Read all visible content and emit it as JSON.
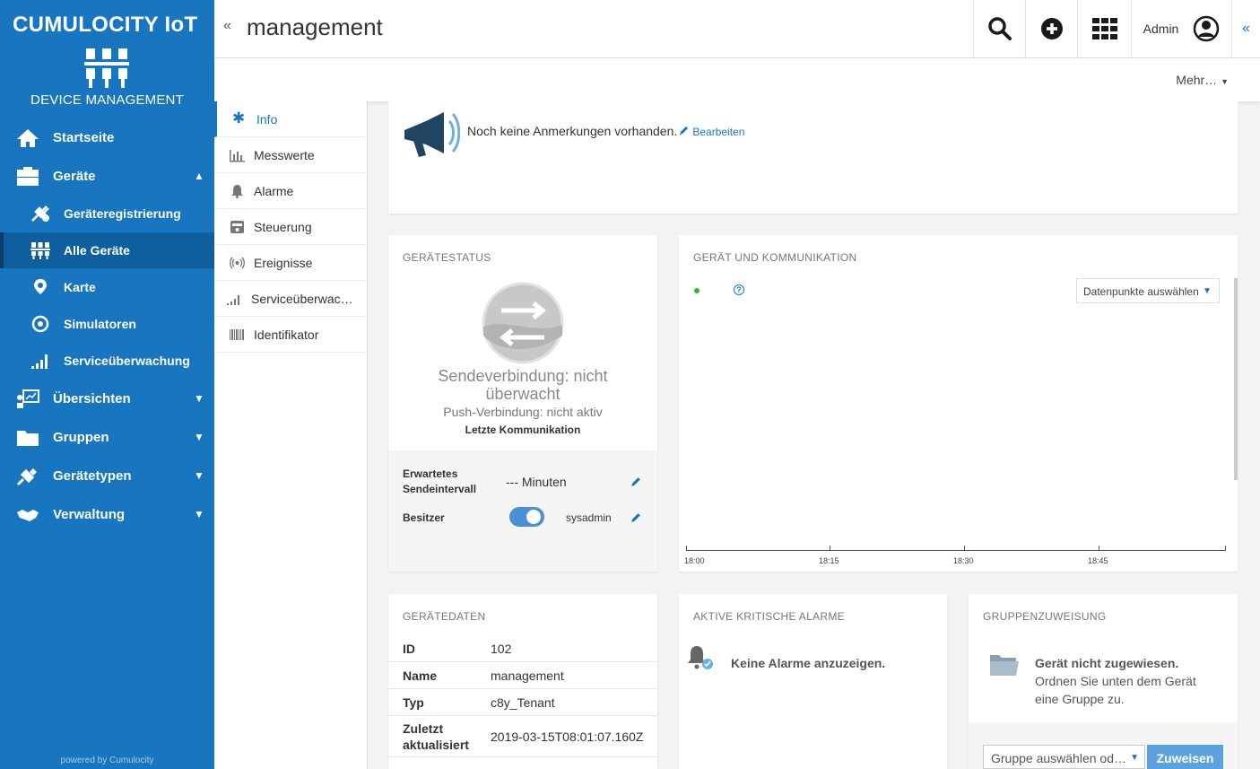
{
  "brand": {
    "title": "CUMULOCITY IoT",
    "subtitle": "DEVICE MANAGEMENT",
    "powered": "powered by Cumulocity"
  },
  "nav": {
    "home": "Startseite",
    "devices": "Geräte",
    "sub": {
      "registration": "Geräteregistrierung",
      "all_devices": "Alle Geräte",
      "map": "Karte",
      "simulators": "Simulatoren",
      "service_monitoring": "Serviceüberwachung"
    },
    "overviews": "Übersichten",
    "groups": "Gruppen",
    "device_types": "Gerätetypen",
    "admin": "Verwaltung"
  },
  "topbar": {
    "collapse": "«",
    "title": "management",
    "user": "Admin",
    "collapse_right": "«"
  },
  "subbar": {
    "more": "Mehr…"
  },
  "tabs": [
    "Info",
    "Messwerte",
    "Alarme",
    "Steuerung",
    "Ereignisse",
    "Serviceüberwac…",
    "Identifikator"
  ],
  "notes": {
    "text": "Noch keine Anmerkungen vorhanden.",
    "edit": "Bearbeiten"
  },
  "status": {
    "title": "GERÄTESTATUS",
    "send_line1": "Sendeverbindung: nicht",
    "send_line2": "überwacht",
    "push": "Push-Verbindung: nicht aktiv",
    "last": "Letzte Kommunikation",
    "interval_label_1": "Erwartetes",
    "interval_label_2": "Sendeintervall",
    "interval_value": "--- Minuten",
    "owner_label": "Besitzer",
    "owner_value": "sysadmin"
  },
  "comm": {
    "title": "GERÄT UND KOMMUNIKATION",
    "help": "?",
    "select": "Datenpunkte auswählen",
    "ticks": [
      "18:00",
      "18:15",
      "18:30",
      "18:45"
    ]
  },
  "devdata": {
    "title": "GERÄTEDATEN",
    "rows": [
      {
        "k": "ID",
        "v": "102"
      },
      {
        "k": "Name",
        "v": "management"
      },
      {
        "k": "Typ",
        "v": "c8y_Tenant"
      },
      {
        "k1": "Zuletzt",
        "k2": "aktualisiert",
        "v": "2019-03-15T08:01:07.160Z"
      }
    ]
  },
  "alarms": {
    "title": "AKTIVE KRITISCHE ALARME",
    "text": "Keine Alarme anzuzeigen."
  },
  "group": {
    "title": "GRUPPENZUWEISUNG",
    "bold": "Gerät nicht zugewiesen.",
    "line1": "Ordnen Sie unten dem Gerät",
    "line2": "eine Gruppe zu.",
    "select": "Gruppe auswählen od…",
    "assign": "Zuweisen"
  },
  "colors": {
    "sidebar": "#1776bf",
    "active": "#0f5f9e",
    "accent": "#1776bf",
    "toggle": "#4a90d9",
    "online": "#2eb82e"
  }
}
